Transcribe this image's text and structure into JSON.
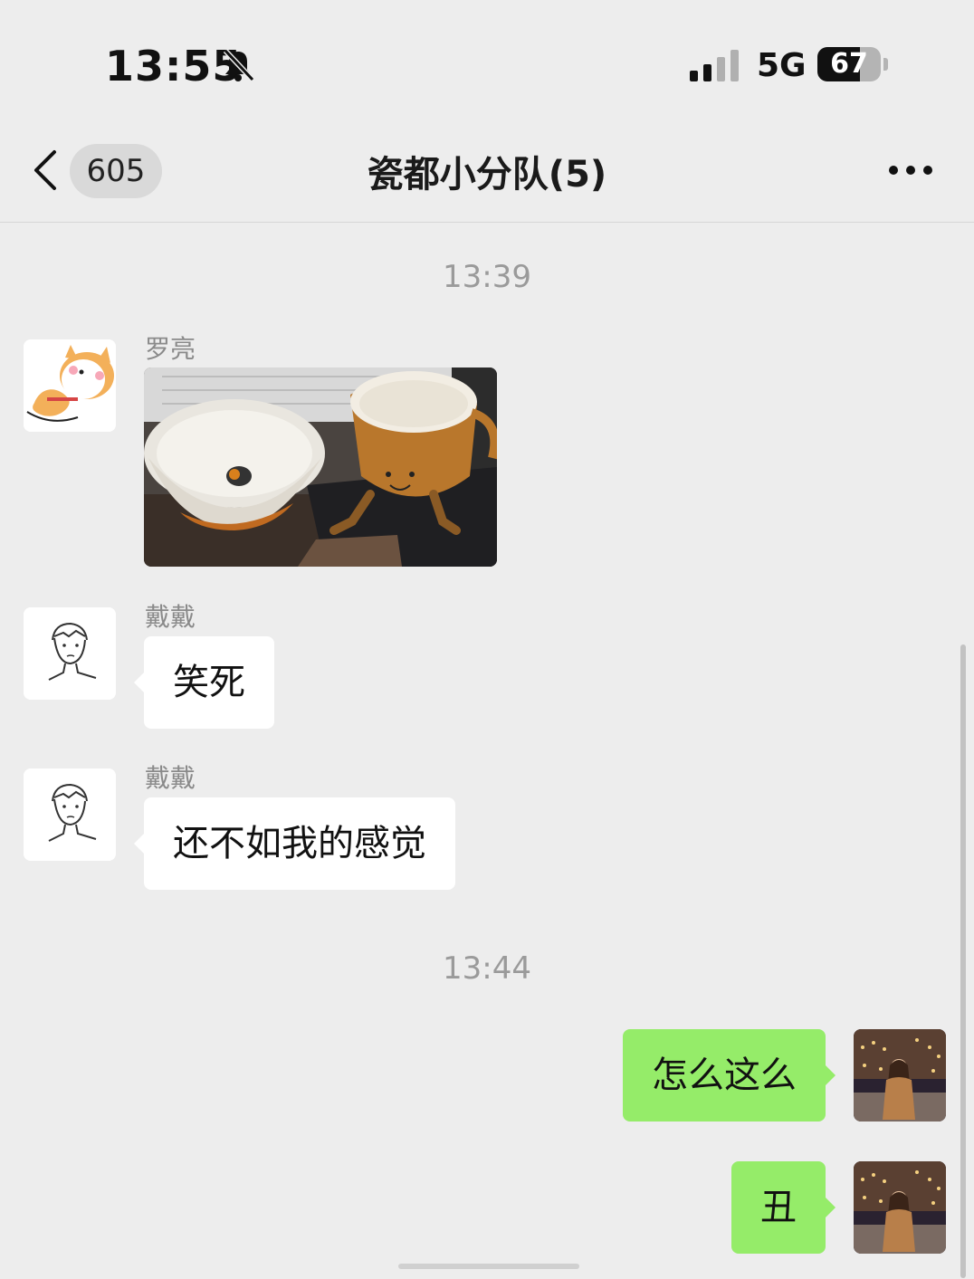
{
  "status_bar": {
    "time": "13:55",
    "network": "5G",
    "battery_level": 67,
    "battery_text": "67",
    "icons": [
      "bell-slash-icon",
      "signal-bars-icon",
      "battery-icon"
    ]
  },
  "nav": {
    "unread_count": "605",
    "title": "瓷都小分队(5)",
    "icons": [
      "chevron-left-icon",
      "more-dots-icon"
    ]
  },
  "messages": {
    "ts1": "13:39",
    "m1": {
      "sender": "罗亮",
      "type": "image",
      "image": "ceramic-bowl-and-cup-photo"
    },
    "m2": {
      "sender": "戴戴",
      "text": "笑死"
    },
    "m3": {
      "sender": "戴戴",
      "text": "还不如我的感觉"
    },
    "ts2": "13:44",
    "m4": {
      "text": "怎么这么",
      "outgoing": true
    },
    "m5": {
      "text": "丑",
      "outgoing": true
    }
  },
  "colors": {
    "background": "#ededed",
    "outgoing_bubble": "#95ec69",
    "incoming_bubble": "#ffffff",
    "timestamp": "#9a9a9a"
  }
}
